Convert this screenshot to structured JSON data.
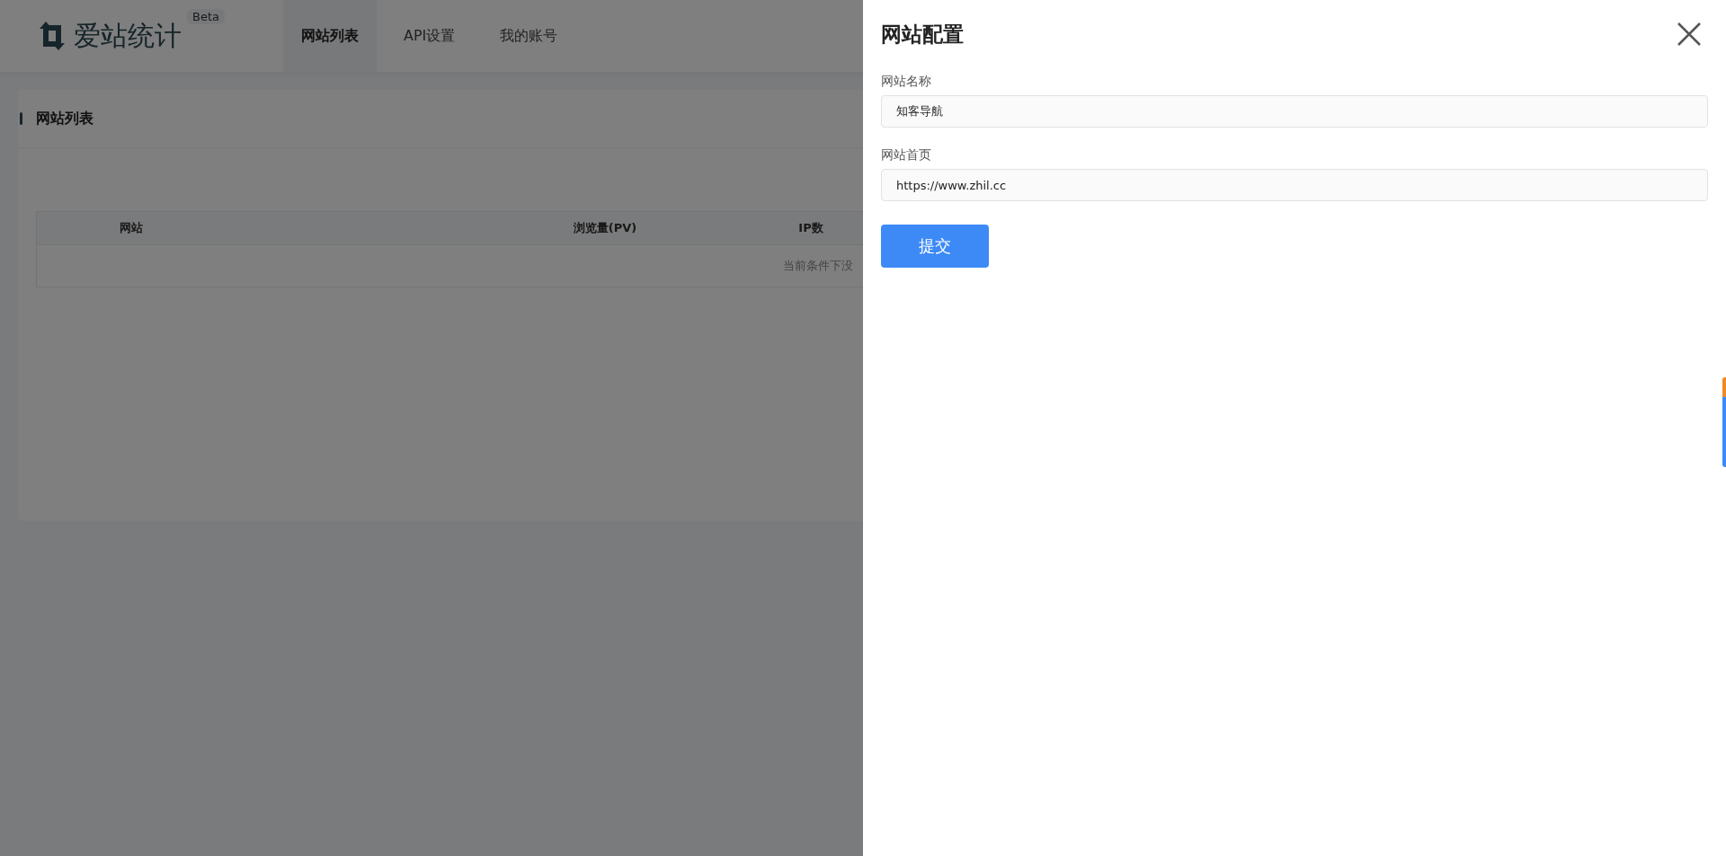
{
  "header": {
    "logo": "爱站统计",
    "badge": "Beta",
    "tabs": [
      {
        "label": "网站列表",
        "selected": true
      },
      {
        "label": "API设置",
        "selected": false
      },
      {
        "label": "我的账号",
        "selected": false
      }
    ]
  },
  "card": {
    "title": "网站列表",
    "table": {
      "columns": [
        "网站",
        "浏览量(PV)",
        "IP数"
      ],
      "empty_text": "当前条件下没"
    }
  },
  "drawer": {
    "title": "网站配置",
    "fields": [
      {
        "label": "网站名称",
        "value": "知客导航"
      },
      {
        "label": "网站首页",
        "value": "https://www.zhil.cc"
      }
    ],
    "submit": "提交"
  }
}
